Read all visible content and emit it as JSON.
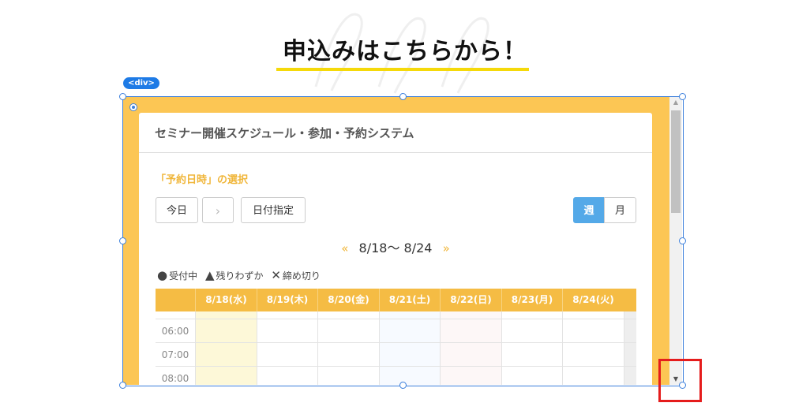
{
  "heading": {
    "title": "申込みはこちらから！"
  },
  "editor": {
    "element_tag": "<div>"
  },
  "widget": {
    "title": "セミナー開催スケジュール・参加・予約システム",
    "section_title": "「予約日時」の選択",
    "buttons": {
      "today": "今日",
      "next": "›",
      "date_pick": "日付指定",
      "week": "週",
      "month": "月"
    },
    "range": {
      "prev": "«",
      "label": "8/18〜 8/24",
      "next": "»"
    },
    "legend": [
      {
        "symbol": "●",
        "label": "受付中"
      },
      {
        "symbol": "▲",
        "label": "残りわずか"
      },
      {
        "symbol": "✕",
        "label": "締め切り"
      }
    ],
    "calendar": {
      "days": [
        "8/18(水)",
        "8/19(木)",
        "8/20(金)",
        "8/21(土)",
        "8/22(日)",
        "8/23(月)",
        "8/24(火)"
      ],
      "times": [
        "06:00",
        "07:00",
        "08:00"
      ]
    }
  },
  "scrollbar": {
    "up": "▲",
    "down": "▼"
  },
  "colors": {
    "accent_yellow": "#fcc654",
    "header_orange": "#f5bc44",
    "week_button_blue": "#54a9e8",
    "highlight_red": "#e51c1c",
    "selection_blue": "#3b7fdc"
  }
}
